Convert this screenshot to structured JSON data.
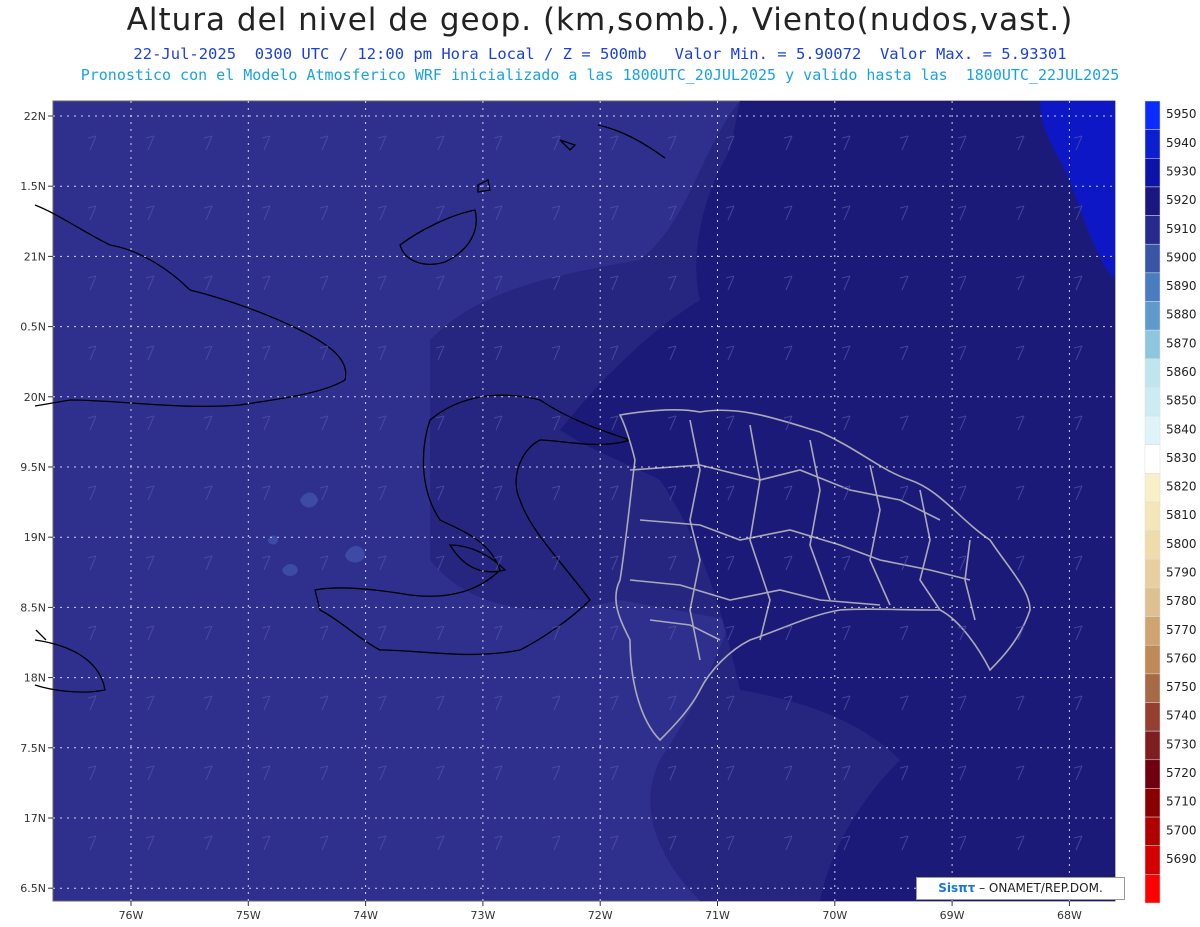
{
  "header": {
    "title": "Altura del nivel de geop. (km,somb.), Viento(nudos,vast.)",
    "subtitle": "22-Jul-2025  0300 UTC / 12:00 pm Hora Local / Z = 500mb   Valor Min. = 5.90072  Valor Max. = 5.93301",
    "run_info": "Pronostico con el Modelo Atmosferico WRF inicializado a las 1800UTC_20JUL2025 y valido hasta las  1800UTC_22JUL2025"
  },
  "map": {
    "lat_labels": [
      "22N",
      "1.5N",
      "21N",
      "0.5N",
      "20N",
      "9.5N",
      "19N",
      "8.5N",
      "18N",
      "7.5N",
      "17N",
      "6.5N"
    ],
    "lon_labels": [
      "76W",
      "75W",
      "74W",
      "73W",
      "72W",
      "71W",
      "70W",
      "69W",
      "68W"
    ],
    "field_colors": {
      "5900": "#3e4ba6",
      "5910": "#2f2f8e",
      "5920": "#262680",
      "5930": "#1c1a78",
      "5940": "#0d17c5"
    }
  },
  "colorbar": {
    "levels": [
      "5950",
      "5940",
      "5930",
      "5920",
      "5910",
      "5900",
      "5890",
      "5880",
      "5870",
      "5860",
      "5850",
      "5840",
      "5830",
      "5820",
      "5810",
      "5800",
      "5790",
      "5780",
      "5770",
      "5760",
      "5750",
      "5740",
      "5730",
      "5720",
      "5710",
      "5700",
      "5690"
    ],
    "colors": [
      "#0a2cff",
      "#0b1fd0",
      "#0d13a8",
      "#1a1880",
      "#262a8c",
      "#3a55a6",
      "#4a7cc0",
      "#5f9acc",
      "#8ec6de",
      "#bfe6ef",
      "#cdebf2",
      "#dff4f8",
      "#ffffff",
      "#f8f0c8",
      "#f4e6b8",
      "#efdcaa",
      "#e8cfa0",
      "#dfc090",
      "#d0a470",
      "#c08a58",
      "#a86a44",
      "#963e30",
      "#7e1e20",
      "#700010",
      "#8a0000",
      "#b00000",
      "#d40000",
      "#ff0000"
    ]
  },
  "credit": {
    "brand": "Sisπτ",
    "text": " –  ONAMET/REP.DOM."
  }
}
